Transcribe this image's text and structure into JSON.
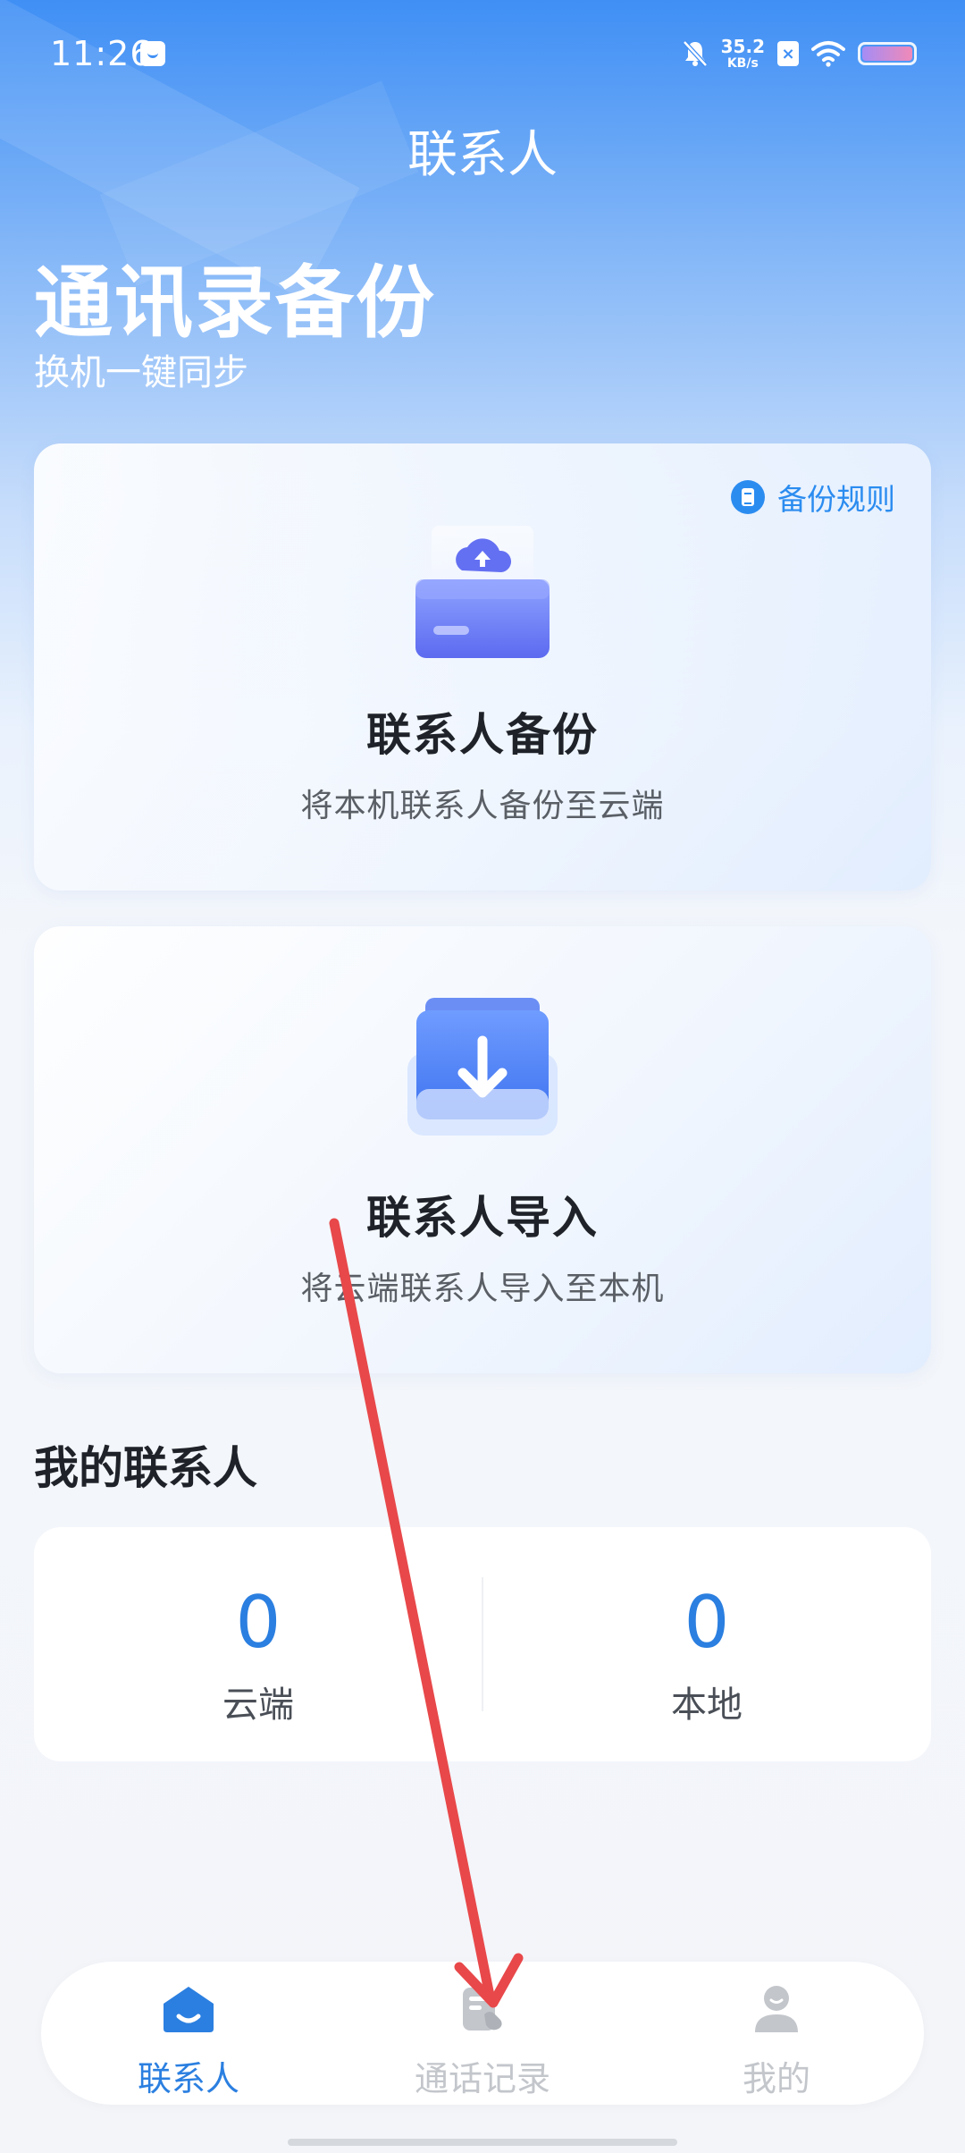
{
  "status_bar": {
    "time": "11:26",
    "net_speed_value": "35.2",
    "net_speed_unit": "KB/s"
  },
  "header": {
    "page_title": "联系人",
    "hero_title": "通讯录备份",
    "hero_subtitle": "换机一键同步"
  },
  "backup_card": {
    "rules_label": "备份规则",
    "title": "联系人备份",
    "subtitle": "将本机联系人备份至云端"
  },
  "import_card": {
    "title": "联系人导入",
    "subtitle": "将云端联系人导入至本机"
  },
  "my_contacts": {
    "title": "我的联系人",
    "cloud": {
      "value": "0",
      "label": "云端"
    },
    "local": {
      "value": "0",
      "label": "本地"
    }
  },
  "bottom_nav": {
    "items": [
      {
        "label": "联系人",
        "icon": "home-contacts-icon",
        "active": true
      },
      {
        "label": "通话记录",
        "icon": "call-log-icon",
        "active": false
      },
      {
        "label": "我的",
        "icon": "profile-icon",
        "active": false
      }
    ]
  },
  "colors": {
    "accent": "#2b7fe0",
    "link": "#2b8cf0",
    "inactive_nav": "#c3c6cb",
    "annotation_arrow": "#e8484a"
  }
}
